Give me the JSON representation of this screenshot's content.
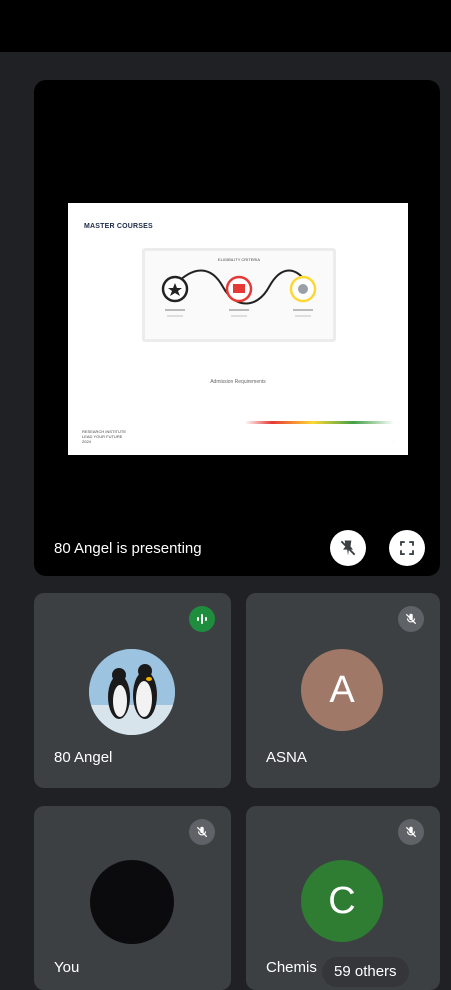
{
  "presentation": {
    "label": "80 Angel is presenting",
    "slide": {
      "title": "MASTER COURSES",
      "panel_heading": "ELIGIBILITY CRITERIA",
      "subtitle": "Admission Requirements",
      "footer_line1": "RESEARCH INSTITUTE",
      "footer_line2": "LEAD YOUR FUTURE",
      "footer_line3": "2024"
    }
  },
  "participants": [
    {
      "name": "80 Angel",
      "status": "speaking",
      "avatar": "penguins-photo"
    },
    {
      "name": "ASNA",
      "status": "muted",
      "initial": "A",
      "color": "#a07868"
    },
    {
      "name": "You",
      "status": "muted",
      "avatar": "dark-photo"
    },
    {
      "name": "Chemis",
      "status": "muted",
      "initial": "C",
      "color": "#2e7d32"
    }
  ],
  "others_label": "59 others",
  "icons": {
    "unpin": "unpin-icon",
    "fullscreen": "fullscreen-icon",
    "mic_off": "mic-off-icon",
    "speaking": "audio-wave-icon"
  }
}
